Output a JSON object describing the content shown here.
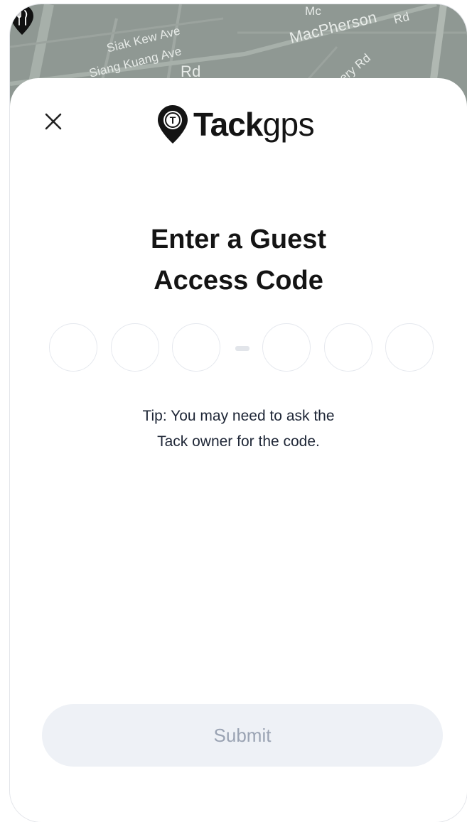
{
  "map": {
    "labels": [
      "Siak Kew Ave",
      "Siang Kuang Ave",
      "Rd",
      "MacPherson",
      "Rd",
      "ery Rd",
      "Mc"
    ],
    "background_color": "#8f9893",
    "poi_icon": "restaurant-icon"
  },
  "header": {
    "close_icon": "close-icon",
    "logo_bold": "Tack",
    "logo_light": "gps",
    "logo_pin_letter": "T"
  },
  "main": {
    "title_line1": "Enter a Guest",
    "title_line2": "Access Code",
    "code_fields": [
      "",
      "",
      "",
      "",
      "",
      ""
    ],
    "separator": "-",
    "tip_line1": "Tip: You may need to ask the",
    "tip_line2": "Tack owner for the code."
  },
  "footer": {
    "submit_label": "Submit"
  },
  "colors": {
    "text": "#141414",
    "button_bg": "#eef1f6",
    "button_text": "#9aa3b3",
    "field_border": "#e5e8ee"
  }
}
